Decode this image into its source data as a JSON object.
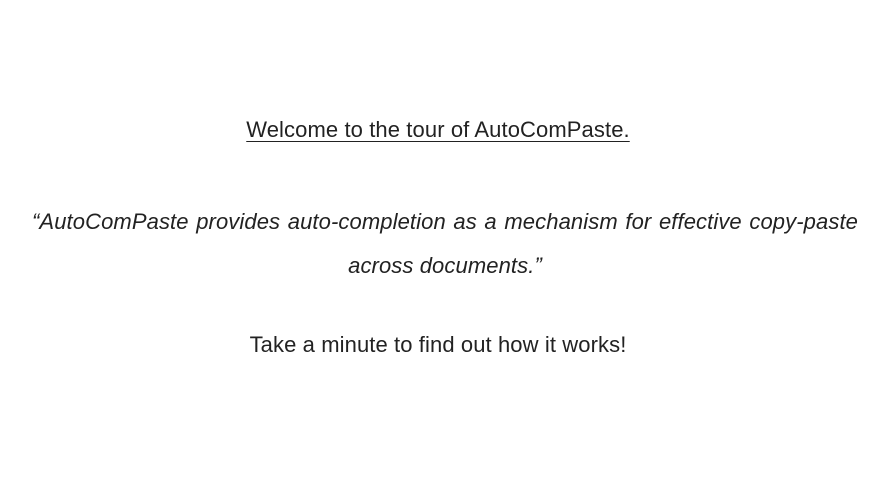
{
  "slide": {
    "title": "Welcome to the tour of AutoComPaste.",
    "quote": "“AutoComPaste provides auto-completion as a mechanism for effective copy-paste across documents.”",
    "call_to_action": "Take a minute to find out how it works!"
  }
}
